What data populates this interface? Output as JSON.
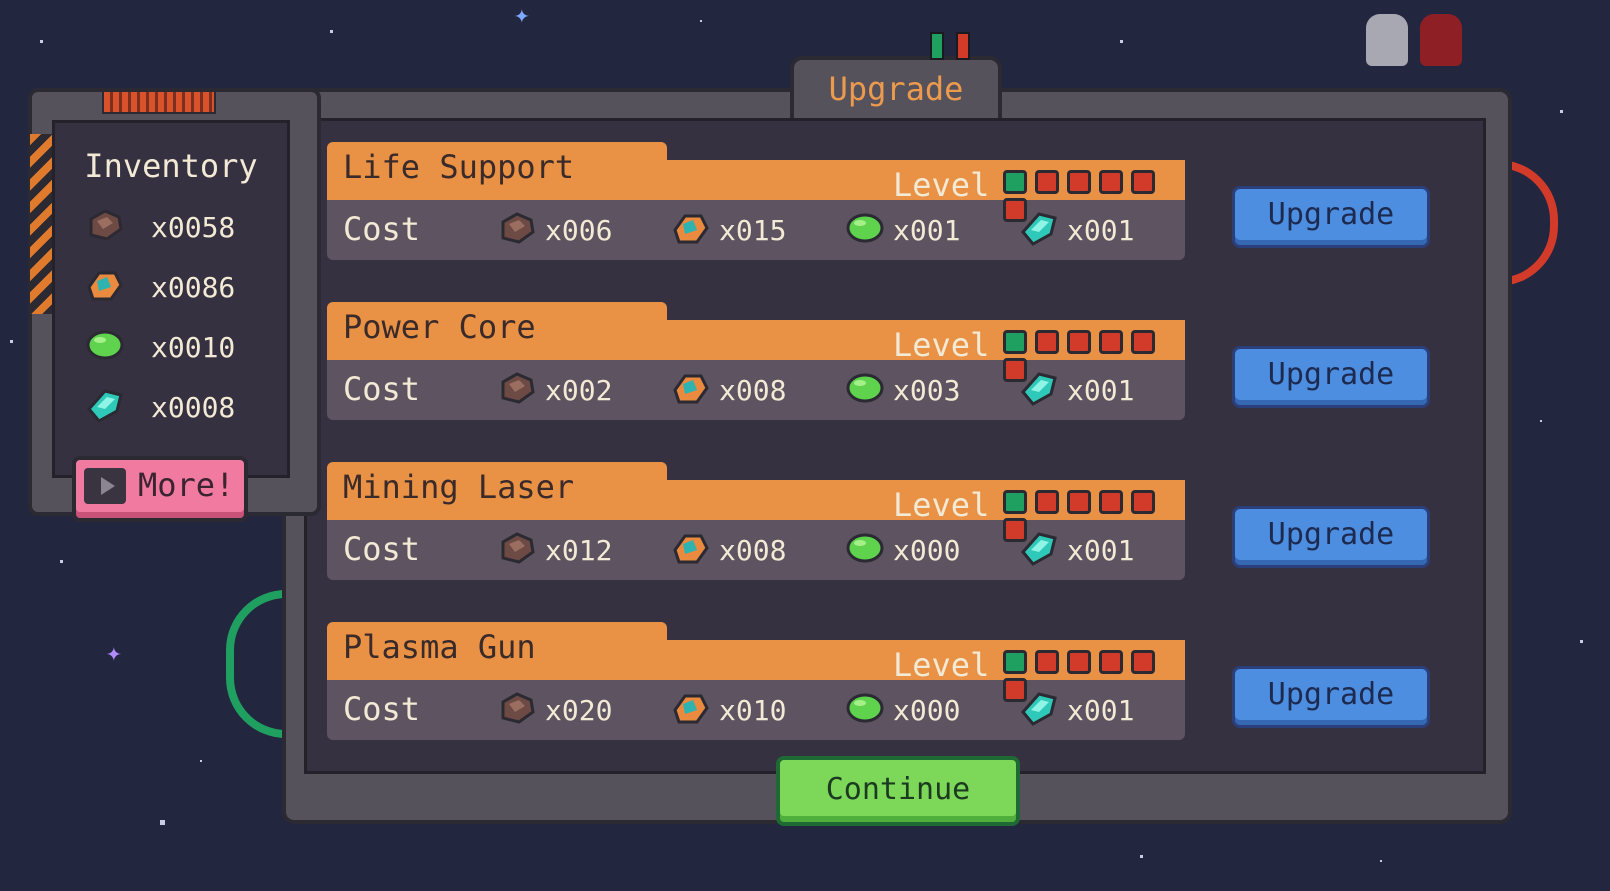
{
  "colors": {
    "background": "#23263f",
    "orange": "#e99245",
    "blue_button": "#4d8ee0",
    "green_button": "#7dd85a",
    "pink_button": "#f07aa0",
    "pip_on": "#1fa060",
    "pip_off": "#d23a2a"
  },
  "header": {
    "title": "Upgrade"
  },
  "inventory": {
    "title": "Inventory",
    "items": [
      {
        "icon": "iron-ore-icon",
        "qty": "x0058"
      },
      {
        "icon": "copper-ore-icon",
        "qty": "x0086"
      },
      {
        "icon": "green-gem-icon",
        "qty": "x0010"
      },
      {
        "icon": "cyan-crystal-icon",
        "qty": "x0008"
      }
    ],
    "more_label": "More!"
  },
  "upgrades": [
    {
      "name": "Life Support",
      "level_label": "Level",
      "level": 1,
      "max_level": 6,
      "cost_label": "Cost",
      "costs": [
        "x006",
        "x015",
        "x001",
        "x001"
      ],
      "button": "Upgrade"
    },
    {
      "name": "Power Core",
      "level_label": "Level",
      "level": 1,
      "max_level": 6,
      "cost_label": "Cost",
      "costs": [
        "x002",
        "x008",
        "x003",
        "x001"
      ],
      "button": "Upgrade"
    },
    {
      "name": "Mining Laser",
      "level_label": "Level",
      "level": 1,
      "max_level": 6,
      "cost_label": "Cost",
      "costs": [
        "x012",
        "x008",
        "x000",
        "x001"
      ],
      "button": "Upgrade"
    },
    {
      "name": "Plasma Gun",
      "level_label": "Level",
      "level": 1,
      "max_level": 6,
      "cost_label": "Cost",
      "costs": [
        "x020",
        "x010",
        "x000",
        "x001"
      ],
      "button": "Upgrade"
    }
  ],
  "continue_label": "Continue"
}
